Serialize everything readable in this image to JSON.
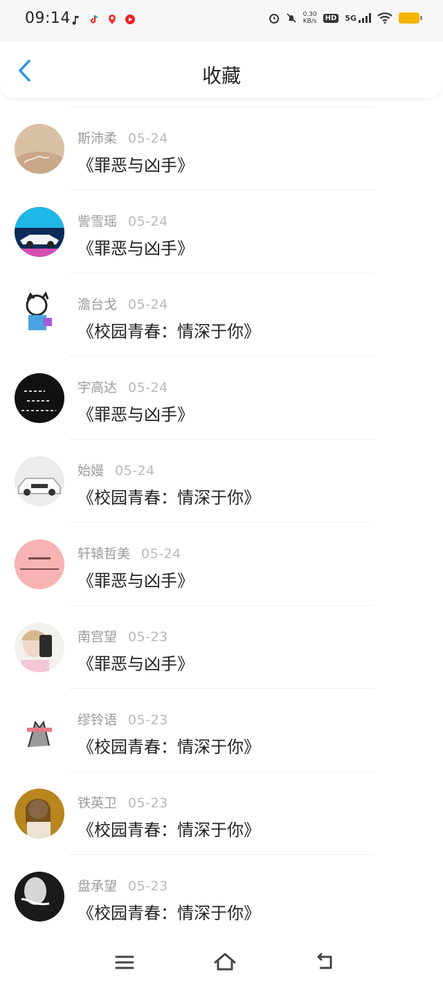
{
  "status_bar": {
    "time": "09:14",
    "net_speed_value": "0.30",
    "net_speed_unit": "KB/s",
    "hd": "HD",
    "signal": "5G",
    "battery_color": "#f5b400"
  },
  "header": {
    "title": "收藏",
    "back_icon": "chevron-left-icon",
    "accent": "#2f95ea"
  },
  "favorites": [
    {
      "name": "斯沛柔",
      "date": "05-24",
      "title": "《罪恶与凶手》"
    },
    {
      "name": "訾雪瑶",
      "date": "05-24",
      "title": "《罪恶与凶手》"
    },
    {
      "name": "澹台戈",
      "date": "05-24",
      "title": "《校园青春：情深于你》"
    },
    {
      "name": "宇高达",
      "date": "05-24",
      "title": "《罪恶与凶手》"
    },
    {
      "name": "始嫚",
      "date": "05-24",
      "title": "《校园青春：情深于你》"
    },
    {
      "name": "轩辕哲美",
      "date": "05-24",
      "title": "《罪恶与凶手》"
    },
    {
      "name": "南宫望",
      "date": "05-23",
      "title": "《罪恶与凶手》"
    },
    {
      "name": "缪铃语",
      "date": "05-23",
      "title": "《校园青春：情深于你》"
    },
    {
      "name": "铁英卫",
      "date": "05-23",
      "title": "《校园青春：情深于你》"
    },
    {
      "name": "盘承望",
      "date": "05-23",
      "title": "《校园青春：情深于你》"
    }
  ],
  "bottom_nav": {
    "menu_icon": "menu-icon",
    "home_icon": "home-icon",
    "back_icon": "return-icon"
  }
}
